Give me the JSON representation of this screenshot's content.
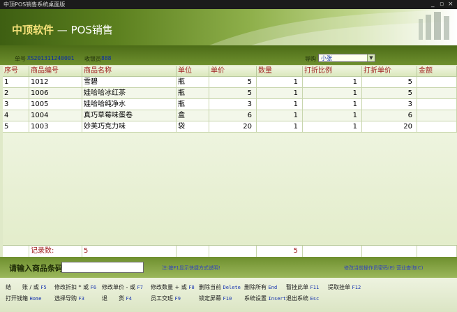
{
  "window": {
    "title": "中顶POS销售系统桌面版",
    "controls": [
      "_",
      "▫",
      "×"
    ]
  },
  "header": {
    "brand": "中顶软件",
    "separator": " — ",
    "module": "POS销售"
  },
  "info": {
    "order_label": "单号",
    "order_value": "XS201311240001",
    "cashier_label": "收银员",
    "cashier_value": "888",
    "guide_label": "导购",
    "guide_value": "小张"
  },
  "table": {
    "columns": [
      "序号",
      "商品编号",
      "商品名称",
      "单位",
      "单价",
      "数量",
      "打折比例",
      "打折单价",
      "金额"
    ],
    "rows": [
      [
        "1",
        "1012",
        "雪碧",
        "瓶",
        "5",
        "1",
        "1",
        "5",
        ""
      ],
      [
        "2",
        "1006",
        "娃哈哈冰红茶",
        "瓶",
        "5",
        "1",
        "1",
        "5",
        ""
      ],
      [
        "3",
        "1005",
        "娃哈哈纯净水",
        "瓶",
        "3",
        "1",
        "1",
        "3",
        ""
      ],
      [
        "4",
        "1004",
        "真巧草莓味蛋卷",
        "盒",
        "6",
        "1",
        "1",
        "6",
        ""
      ],
      [
        "5",
        "1003",
        "妙芙巧克力味",
        "袋",
        "20",
        "1",
        "1",
        "20",
        ""
      ]
    ],
    "footer": {
      "label": "记录数:",
      "count": "5",
      "qty_total": "5"
    }
  },
  "input": {
    "label": "请输入商品条码",
    "value": "",
    "note": "注:按F1显示快捷方式说明!",
    "right_link": "修改当前操作员密码(E) 营业查询(C)"
  },
  "shortcuts": {
    "row1": [
      {
        "label": "结　　账 / 或",
        "key": "F5"
      },
      {
        "label": "修改折扣 * 或",
        "key": "F6"
      },
      {
        "label": "修改单价 - 或",
        "key": "F7"
      },
      {
        "label": "修改数量 + 或",
        "key": "F8"
      },
      {
        "label": "删除当前",
        "key": "Delete"
      },
      {
        "label": "删除所有",
        "key": "End"
      },
      {
        "label": "暂挂此单",
        "key": "F11"
      },
      {
        "label": "提取挂单",
        "key": "F12"
      }
    ],
    "row2": [
      {
        "label": "打开钱箱",
        "key": "Home"
      },
      {
        "label": "选择导购",
        "key": "F3"
      },
      {
        "label": "退　　货",
        "key": "F4"
      },
      {
        "label": "员工交班",
        "key": "F9"
      },
      {
        "label": "锁定屏幕",
        "key": "F10"
      },
      {
        "label": "系统设置",
        "key": "Insert"
      },
      {
        "label": "退出系统",
        "key": "Esc"
      }
    ]
  },
  "colors": {
    "header_dark": "#3e5f12",
    "accent_blue": "#0a2aa8",
    "header_text_red": "#a02020"
  }
}
